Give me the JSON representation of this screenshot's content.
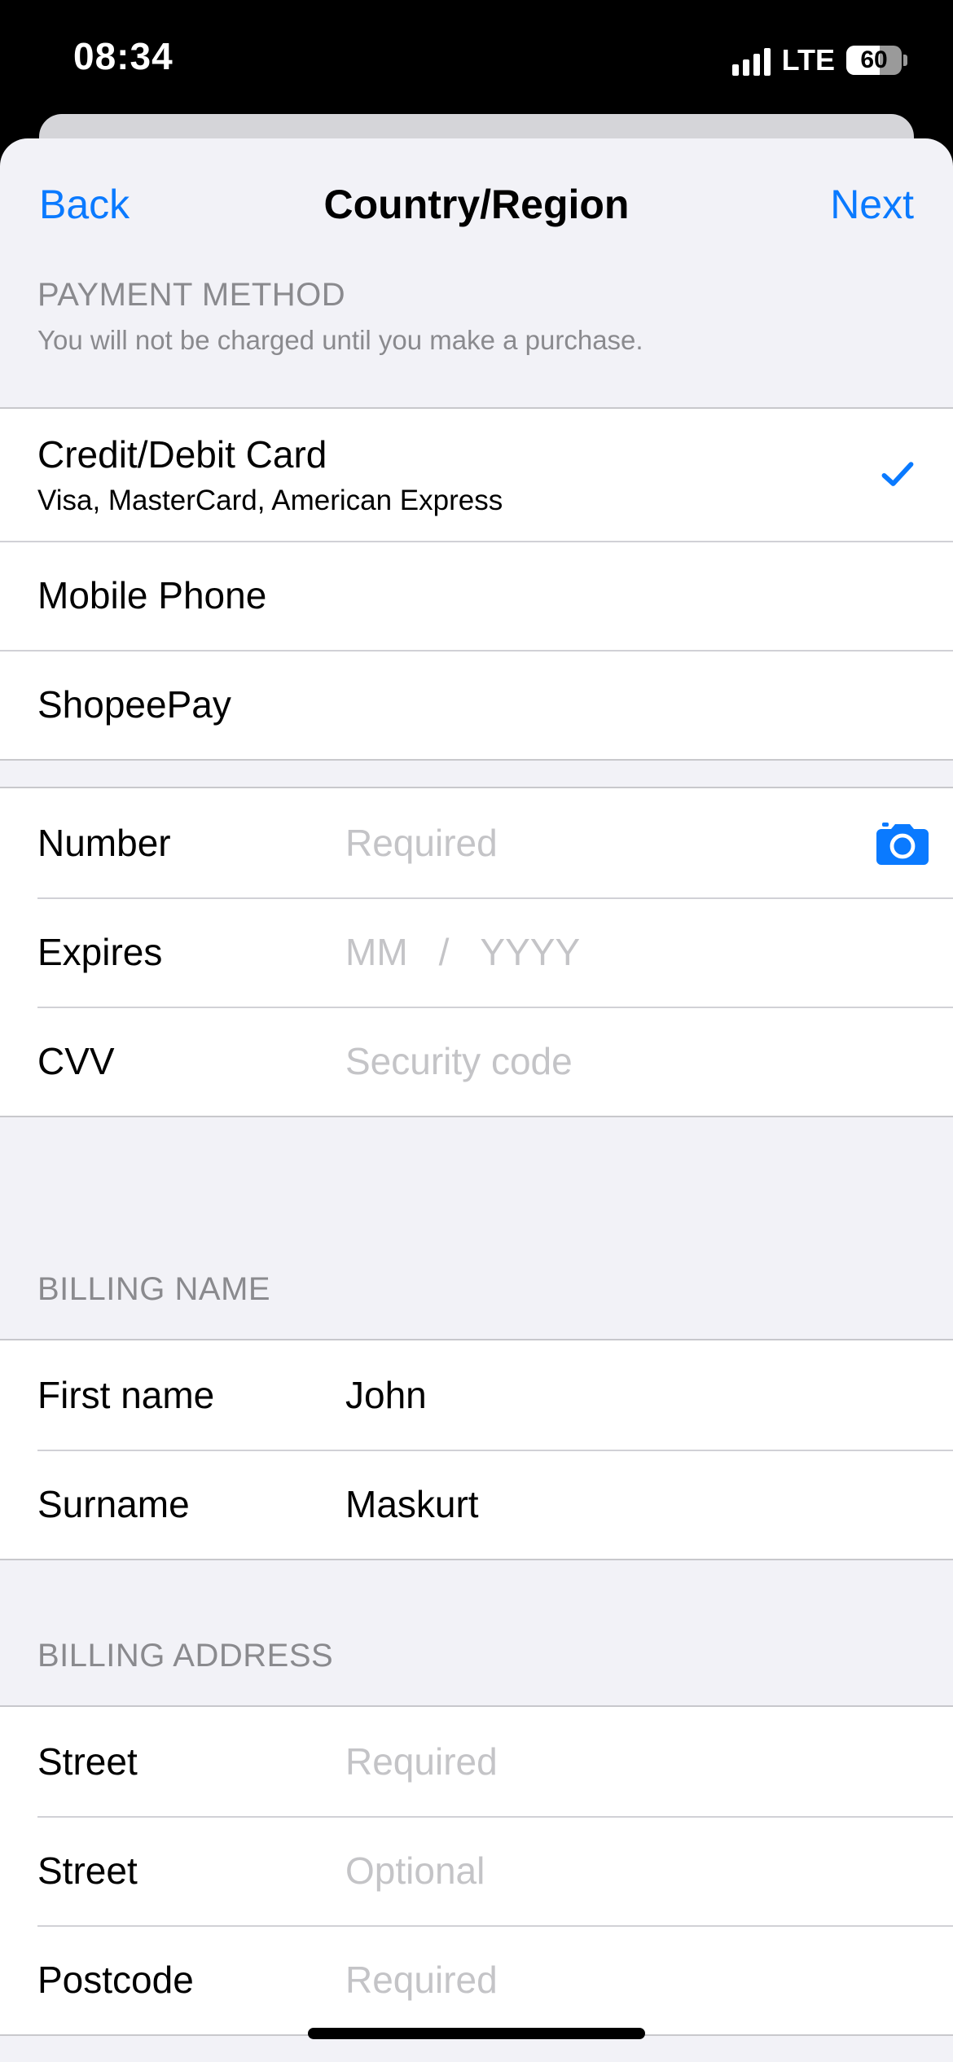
{
  "status_bar": {
    "time": "08:34",
    "network": "LTE",
    "battery": "60",
    "battery_fraction": 0.6
  },
  "nav": {
    "back_label": "Back",
    "title": "Country/Region",
    "next_label": "Next"
  },
  "payment_method": {
    "header": "PAYMENT METHOD",
    "subtitle": "You will not be charged until you make a purchase.",
    "options": [
      {
        "label": "Credit/Debit Card",
        "detail": "Visa, MasterCard, American Express",
        "selected": true
      },
      {
        "label": "Mobile Phone"
      },
      {
        "label": "ShopeePay"
      }
    ]
  },
  "card": {
    "number": {
      "label": "Number",
      "placeholder": "Required"
    },
    "expires": {
      "label": "Expires",
      "month_placeholder": "MM",
      "separator": "/",
      "year_placeholder": "YYYY"
    },
    "cvv": {
      "label": "CVV",
      "placeholder": "Security code"
    }
  },
  "billing_name": {
    "header": "BILLING NAME",
    "first_name": {
      "label": "First name",
      "value": "John"
    },
    "surname": {
      "label": "Surname",
      "value": "Maskurt"
    }
  },
  "billing_address": {
    "header": "BILLING ADDRESS",
    "street1": {
      "label": "Street",
      "placeholder": "Required"
    },
    "street2": {
      "label": "Street",
      "placeholder": "Optional"
    },
    "postcode": {
      "label": "Postcode",
      "placeholder": "Required"
    }
  },
  "colors": {
    "accent": "#0a7aff",
    "background": "#f2f2f7",
    "placeholder": "#c4c4c7",
    "secondary_text": "#8a8a8e"
  },
  "icons": {
    "selected": "checkmark-icon",
    "scan_card": "camera-icon"
  }
}
